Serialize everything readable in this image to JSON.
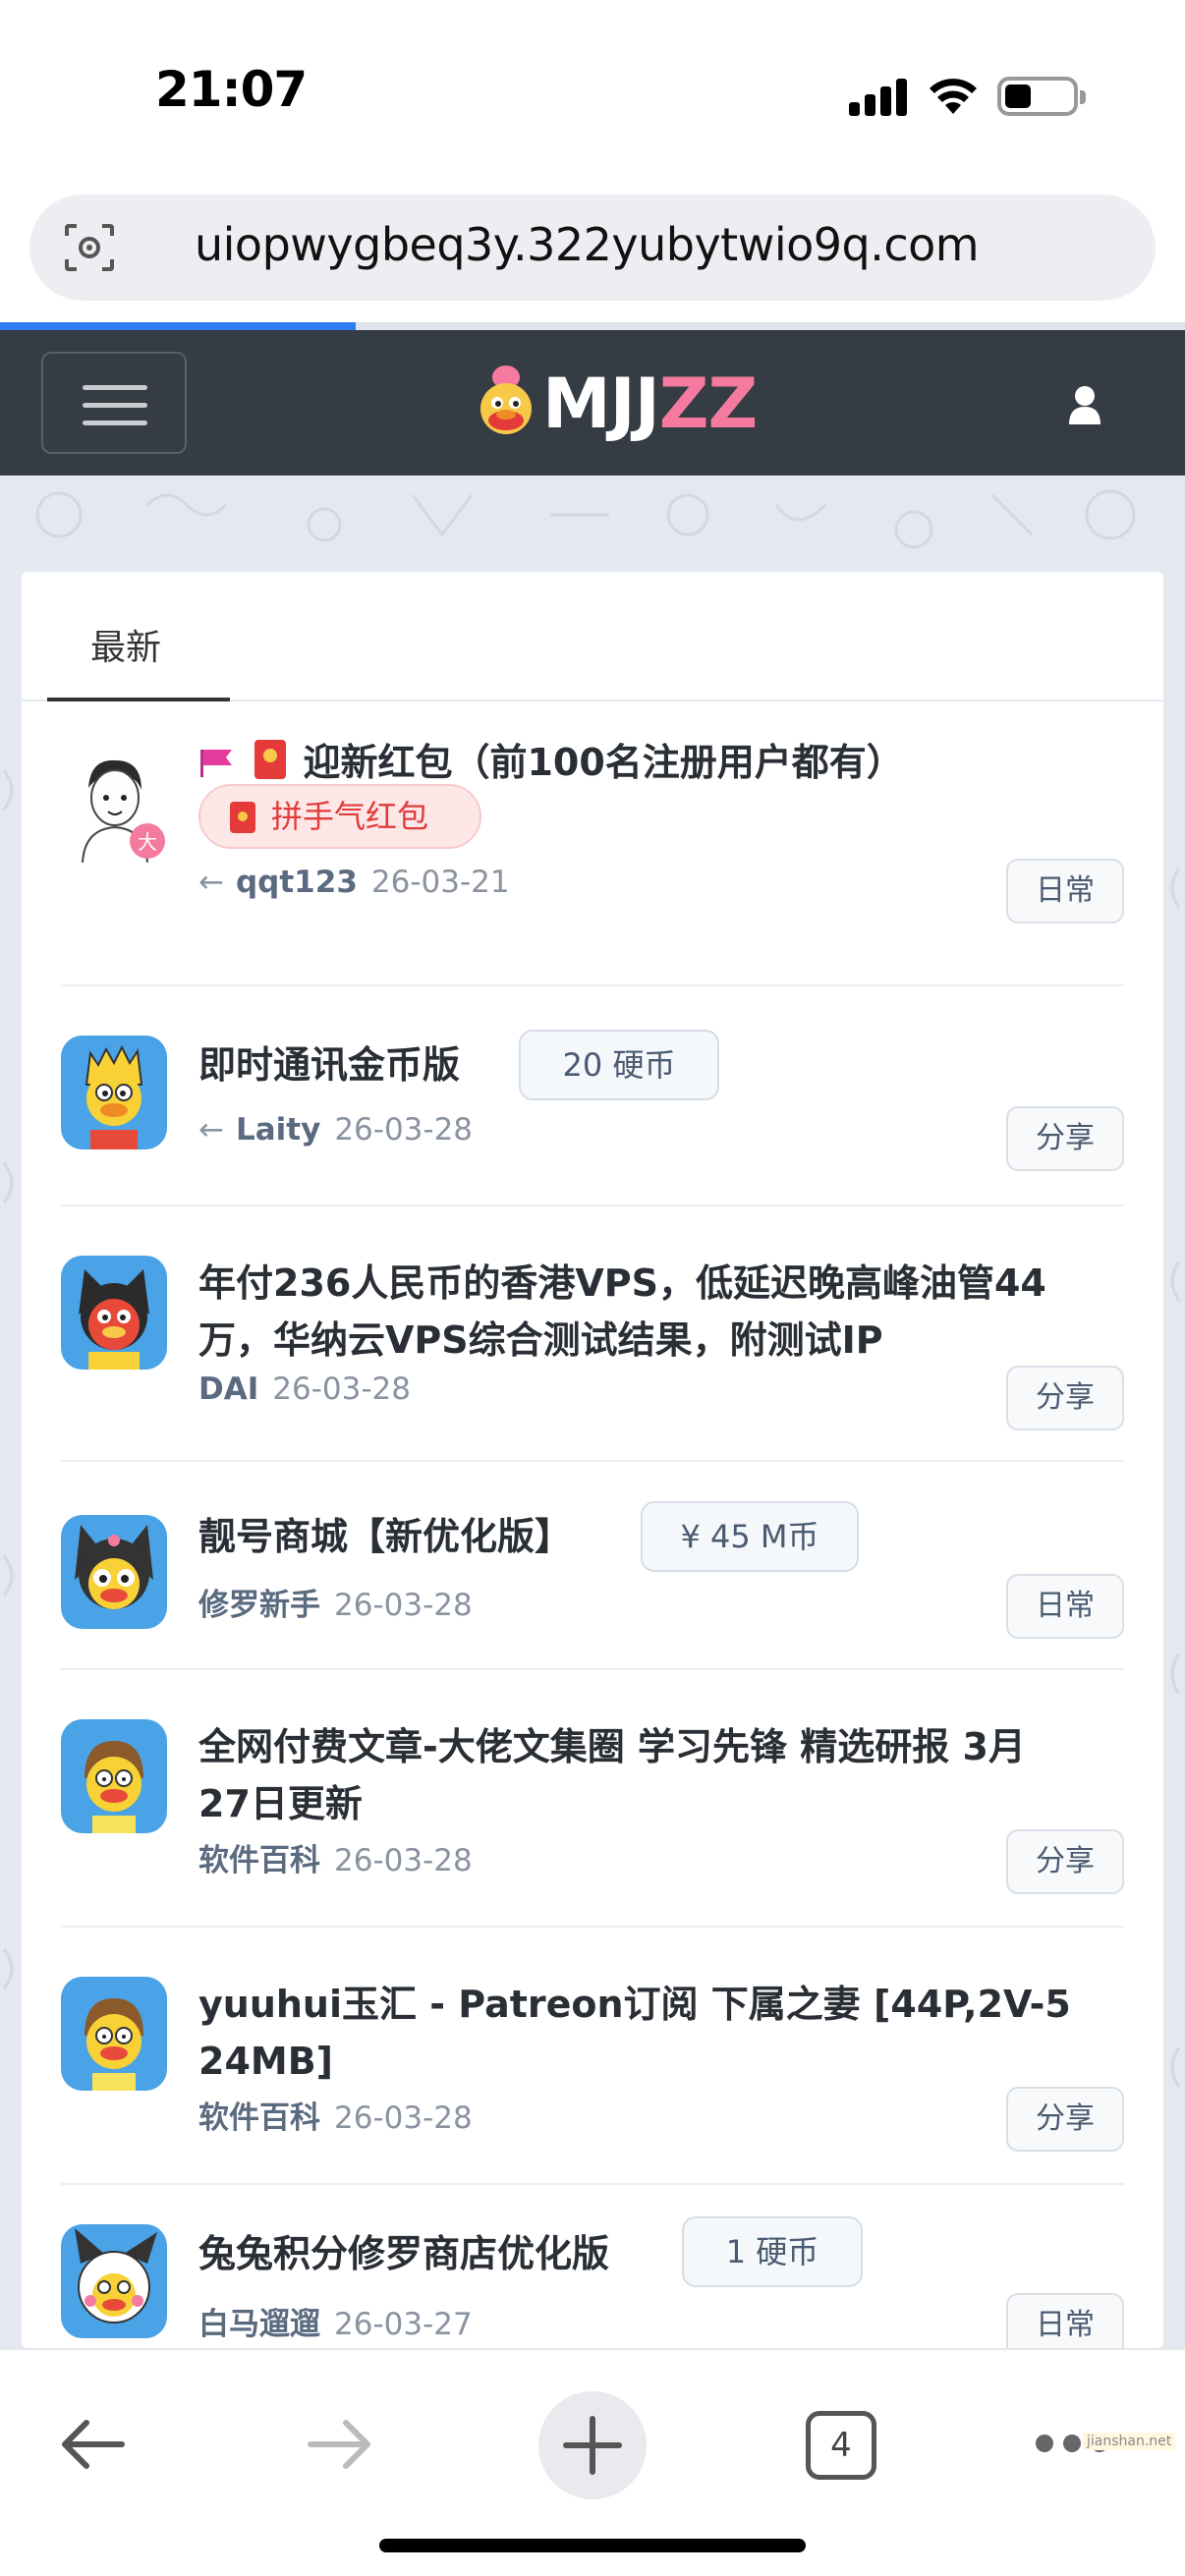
{
  "status_bar": {
    "time": "21:07"
  },
  "browser": {
    "url": "uiopwygbeq3y.322yubytwio9q.com",
    "load_progress": 0.3,
    "tab_count": "4",
    "watermark": "jianshan.net"
  },
  "site": {
    "logo_white": "MJJ",
    "logo_pink": "ZZ"
  },
  "tabs": {
    "newest": "最新"
  },
  "posts": [
    {
      "title": "迎新红包（前100名注册用户都有）",
      "badge": "拼手气红包",
      "arrow": "←",
      "author": "qqt123",
      "date": "26-03-21",
      "tag": "日常"
    },
    {
      "title": "即时通讯金币版",
      "pill": "20 硬币",
      "arrow": "←",
      "author": "Laity",
      "date": "26-03-28",
      "tag": "分享"
    },
    {
      "title_line1": "年付236人民币的香港VPS，低延迟晚高峰油管44",
      "title_line2": "万，华纳云VPS综合测试结果，附测试IP",
      "author": "DAI",
      "date": "26-03-28",
      "tag": "分享"
    },
    {
      "title": "靓号商城【新优化版】",
      "pill": "¥ 45 M币",
      "author": "修罗新手",
      "date": "26-03-28",
      "tag": "日常"
    },
    {
      "title_line1": "全网付费文章-大佬文集圈 学习先锋 精选研报 3月",
      "title_line2": "27日更新",
      "author": "软件百科",
      "date": "26-03-28",
      "tag": "分享"
    },
    {
      "title_line1": "yuuhui玉汇 - Patreon订阅 下属之妻 [44P,2V-5",
      "title_line2": "24MB]",
      "author": "软件百科",
      "date": "26-03-28",
      "tag": "分享"
    },
    {
      "title": "兔兔积分修罗商店优化版",
      "pill": "1 硬币",
      "author": "白马遛遛",
      "date": "26-03-27",
      "tag": "日常"
    }
  ],
  "colors": {
    "header_bg": "#363c44",
    "logo_accent": "#f47b9f",
    "progress": "#2f7cf6",
    "redpacket": "#e13b3b"
  }
}
